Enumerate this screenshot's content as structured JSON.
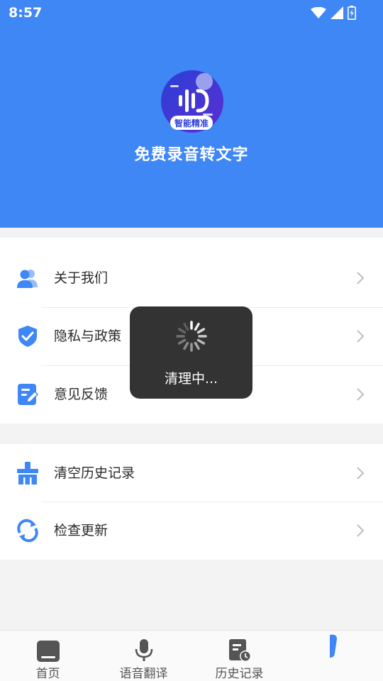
{
  "status_bar": {
    "time": "8:57"
  },
  "app": {
    "title": "免费录音转文字",
    "logo_badge": "智能精准"
  },
  "menu": {
    "group1": [
      {
        "label": "关于我们",
        "icon": "users-icon"
      },
      {
        "label": "隐私与政策",
        "icon": "shield-check-icon"
      },
      {
        "label": "意见反馈",
        "icon": "edit-note-icon"
      }
    ],
    "group2": [
      {
        "label": "清空历史记录",
        "icon": "broom-icon"
      },
      {
        "label": "检查更新",
        "icon": "refresh-icon"
      }
    ]
  },
  "toast": {
    "text": "清理中..."
  },
  "bottom_nav": {
    "items": [
      {
        "label": "首页",
        "icon": "home-icon"
      },
      {
        "label": "语音翻译",
        "icon": "microphone-icon"
      },
      {
        "label": "历史记录",
        "icon": "history-icon"
      },
      {
        "label": "",
        "icon": "profile-icon"
      }
    ]
  },
  "colors": {
    "header": "#3f87f5",
    "accent": "#3f87f5",
    "nav_icon": "#555555"
  }
}
